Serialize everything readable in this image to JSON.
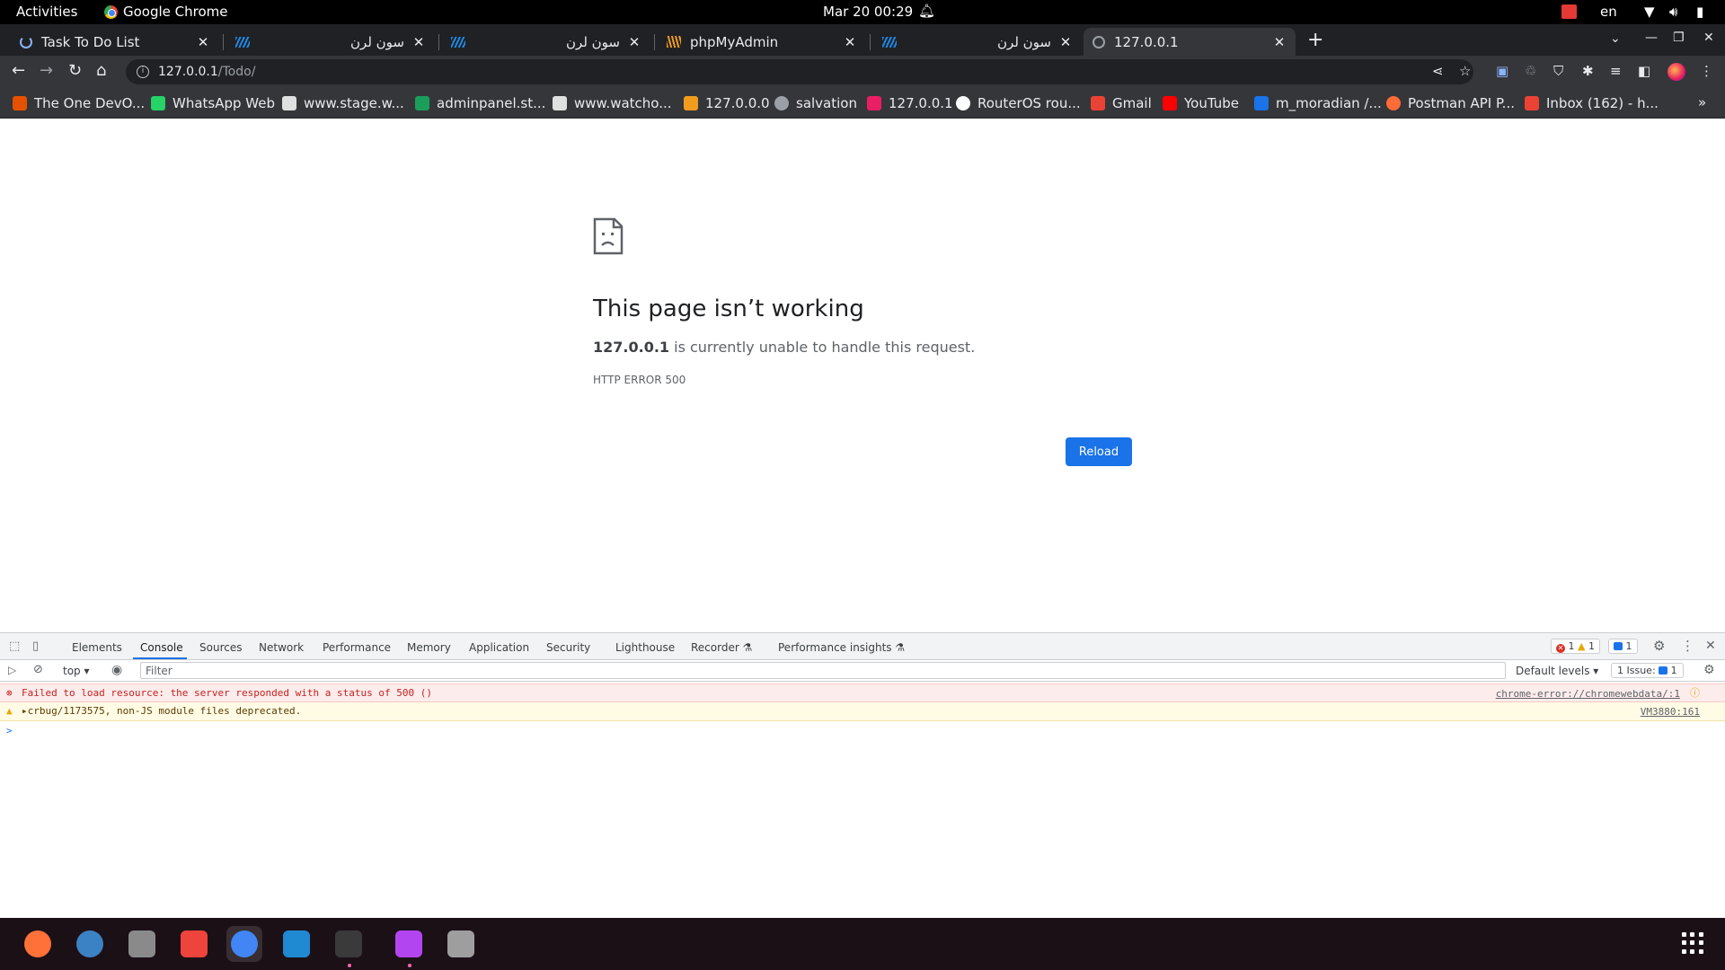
{
  "topbar": {
    "activities": "Activities",
    "app_name": "Google Chrome",
    "clock": "Mar 20  00:29",
    "lang": "en"
  },
  "tabs": [
    {
      "title": "Task To Do List",
      "favicon": "spinner-icon",
      "rtl": false,
      "active": false
    },
    {
      "title": "سون لرن",
      "favicon": "wing-icon",
      "rtl": true,
      "active": false
    },
    {
      "title": "سون لرن",
      "favicon": "wing-icon",
      "rtl": true,
      "active": false
    },
    {
      "title": "phpMyAdmin",
      "favicon": "phpmyadmin-icon",
      "rtl": false,
      "active": false
    },
    {
      "title": "سون لرن",
      "favicon": "wing-icon",
      "rtl": true,
      "active": false
    },
    {
      "title": "127.0.0.1",
      "favicon": "globe-icon",
      "rtl": false,
      "active": true
    }
  ],
  "toolbar": {
    "url_host": "127.0.0.1",
    "url_path": "/Todo/"
  },
  "bookmarks": [
    {
      "label": "The One DevO...",
      "color": "#e65100"
    },
    {
      "label": "WhatsApp Web",
      "color": "#25d366"
    },
    {
      "label": "www.stage.w...",
      "color": "#e0e0e0"
    },
    {
      "label": "adminpanel.st...",
      "color": "#1b9e5a"
    },
    {
      "label": "www.watcho...",
      "color": "#e0e0e0"
    },
    {
      "label": "127.0.0.0",
      "color": "#f29c1f"
    },
    {
      "label": "salvation",
      "color": "#9aa0a6"
    },
    {
      "label": "127.0.0.1",
      "color": "#e91e63"
    },
    {
      "label": "RouterOS rou...",
      "color": "#ffffff"
    },
    {
      "label": "Gmail",
      "color": "#ea4335"
    },
    {
      "label": "YouTube",
      "color": "#ff0000"
    },
    {
      "label": "m_moradian /...",
      "color": "#1a73e8"
    },
    {
      "label": "Postman API P...",
      "color": "#ff6c37"
    },
    {
      "label": "Inbox (162) - h...",
      "color": "#ea4335"
    }
  ],
  "error_page": {
    "title": "This page isn’t working",
    "host": "127.0.0.1",
    "desc_rest": " is currently unable to handle this request.",
    "code": "HTTP ERROR 500",
    "reload": "Reload"
  },
  "devtools": {
    "tabs": [
      "Elements",
      "Console",
      "Sources",
      "Network",
      "Performance",
      "Memory",
      "Application",
      "Security",
      "Lighthouse",
      "Recorder ⚗",
      "Performance insights ⚗"
    ],
    "active_tab": "Console",
    "error_count": "1",
    "warn_count": "1",
    "info_count": "1",
    "context": "top",
    "filter_placeholder": "Filter",
    "levels": "Default levels",
    "issues_label": "1 Issue:",
    "issues_count": "1",
    "messages": [
      {
        "level": "error",
        "text": "Failed to load resource: the server responded with a status of 500 ()",
        "source": "chrome-error://chromewebdata/:1"
      },
      {
        "level": "warning",
        "text": "crbug/1173575, non-JS module files deprecated.",
        "source": "VM3880:161"
      }
    ],
    "prompt": ">"
  },
  "dock": [
    {
      "name": "firefox-icon",
      "color": "#ff7139"
    },
    {
      "name": "thunderbird-icon",
      "color": "#3b82c4"
    },
    {
      "name": "files-icon",
      "color": "#8a8a8a"
    },
    {
      "name": "anydesk-icon",
      "color": "#ef443b"
    },
    {
      "name": "chrome-icon",
      "color": "#4285f4"
    },
    {
      "name": "vscode-icon",
      "color": "#1f8ad2"
    },
    {
      "name": "terminal-icon",
      "color": "#3a3a3a"
    },
    {
      "name": "phpstorm-icon",
      "color": "#b345f1"
    },
    {
      "name": "trash-icon",
      "color": "#9e9e9e"
    }
  ]
}
